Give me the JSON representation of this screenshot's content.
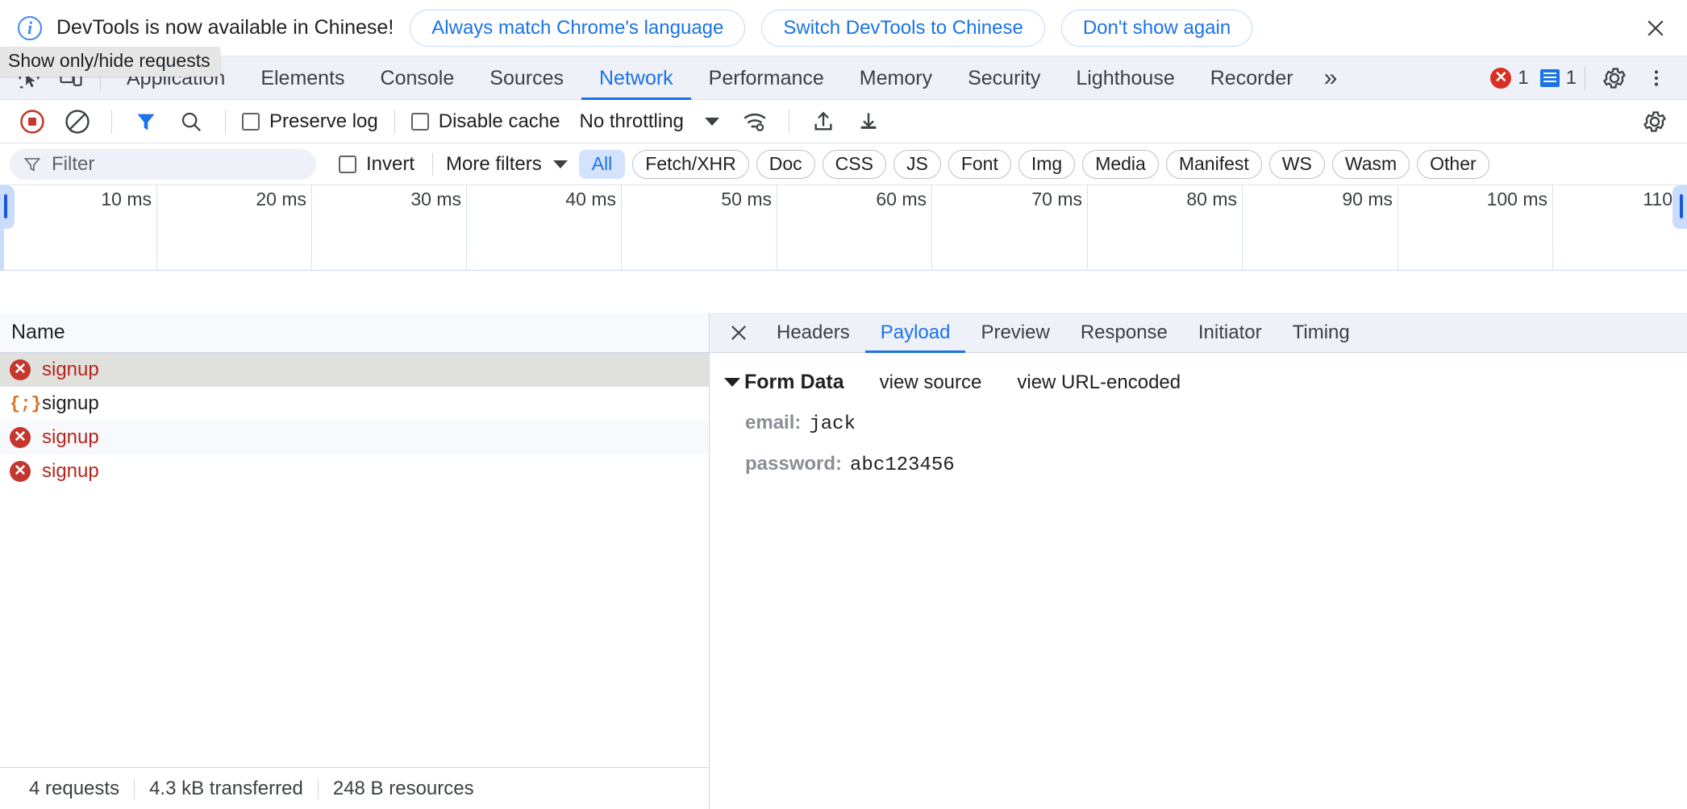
{
  "infobar": {
    "icon": "info-circle-icon",
    "message": "DevTools is now available in Chinese!",
    "buttons": [
      {
        "label": "Always match Chrome's language",
        "name": "always-match-language-button"
      },
      {
        "label": "Switch DevTools to Chinese",
        "name": "switch-devtools-chinese-button"
      },
      {
        "label": "Don't show again",
        "name": "dont-show-again-button"
      }
    ],
    "close_icon": "close-icon"
  },
  "tooltip": {
    "text": "Show only/hide requests"
  },
  "tabbar": {
    "inspect_icon": "inspect-element-icon",
    "device_icon": "device-toolbar-icon",
    "tabs": [
      {
        "label": "Application",
        "active": false
      },
      {
        "label": "Elements",
        "active": false
      },
      {
        "label": "Console",
        "active": false
      },
      {
        "label": "Sources",
        "active": false
      },
      {
        "label": "Network",
        "active": true
      },
      {
        "label": "Performance",
        "active": false
      },
      {
        "label": "Memory",
        "active": false
      },
      {
        "label": "Security",
        "active": false
      },
      {
        "label": "Lighthouse",
        "active": false
      },
      {
        "label": "Recorder",
        "active": false
      }
    ],
    "more_tabs": "»",
    "error_count": "1",
    "message_count": "1",
    "settings_icon": "gear-icon",
    "menu_icon": "kebab-menu-icon"
  },
  "network_toolbar": {
    "record_icon": "record-stop-icon",
    "clear_icon": "clear-network-icon",
    "filter_icon": "filter-funnel-icon",
    "search_icon": "search-icon",
    "preserve_log_label": "Preserve log",
    "preserve_log_checked": false,
    "disable_cache_label": "Disable cache",
    "disable_cache_checked": false,
    "throttling_value": "No throttling",
    "wifi_icon": "network-conditions-icon",
    "import_icon": "import-har-icon",
    "export_icon": "export-har-icon",
    "settings_icon": "network-settings-gear-icon"
  },
  "filter_row": {
    "filter_placeholder": "Filter",
    "filter_value": "",
    "filter_icon": "filter-funnel-icon",
    "invert_label": "Invert",
    "invert_checked": false,
    "more_filters_label": "More filters",
    "chips": [
      {
        "label": "All",
        "active": true
      },
      {
        "label": "Fetch/XHR",
        "active": false
      },
      {
        "label": "Doc",
        "active": false
      },
      {
        "label": "CSS",
        "active": false
      },
      {
        "label": "JS",
        "active": false
      },
      {
        "label": "Font",
        "active": false
      },
      {
        "label": "Img",
        "active": false
      },
      {
        "label": "Media",
        "active": false
      },
      {
        "label": "Manifest",
        "active": false
      },
      {
        "label": "WS",
        "active": false
      },
      {
        "label": "Wasm",
        "active": false
      },
      {
        "label": "Other",
        "active": false
      }
    ]
  },
  "timeline": {
    "ticks": [
      "10 ms",
      "20 ms",
      "30 ms",
      "40 ms",
      "50 ms",
      "60 ms",
      "70 ms",
      "80 ms",
      "90 ms",
      "100 ms",
      "110"
    ]
  },
  "requests_panel": {
    "column_header": "Name",
    "rows": [
      {
        "name": "signup",
        "status": "error",
        "icon": "error-circle-icon",
        "selected": true
      },
      {
        "name": "signup",
        "status": "json",
        "icon": "json-braces-icon",
        "selected": false
      },
      {
        "name": "signup",
        "status": "error",
        "icon": "error-circle-icon",
        "selected": false
      },
      {
        "name": "signup",
        "status": "error",
        "icon": "error-circle-icon",
        "selected": false
      }
    ]
  },
  "status_bar": {
    "requests": "4 requests",
    "transferred": "4.3 kB transferred",
    "resources": "248 B resources"
  },
  "details_panel": {
    "close_icon": "close-icon",
    "tabs": [
      {
        "label": "Headers",
        "active": false
      },
      {
        "label": "Payload",
        "active": true
      },
      {
        "label": "Preview",
        "active": false
      },
      {
        "label": "Response",
        "active": false
      },
      {
        "label": "Initiator",
        "active": false
      },
      {
        "label": "Timing",
        "active": false
      }
    ],
    "form_data": {
      "section_title": "Form Data",
      "view_source_label": "view source",
      "view_url_encoded_label": "view URL-encoded",
      "fields": [
        {
          "key": "email:",
          "value": "jack"
        },
        {
          "key": "password:",
          "value": "abc123456"
        }
      ]
    }
  },
  "colors": {
    "accent": "#1a73e8",
    "error": "#c5362c",
    "chip_active_bg": "#d3e3fd",
    "tabbar_bg": "#eef1f8",
    "selected_row": "#e0e0dd"
  }
}
